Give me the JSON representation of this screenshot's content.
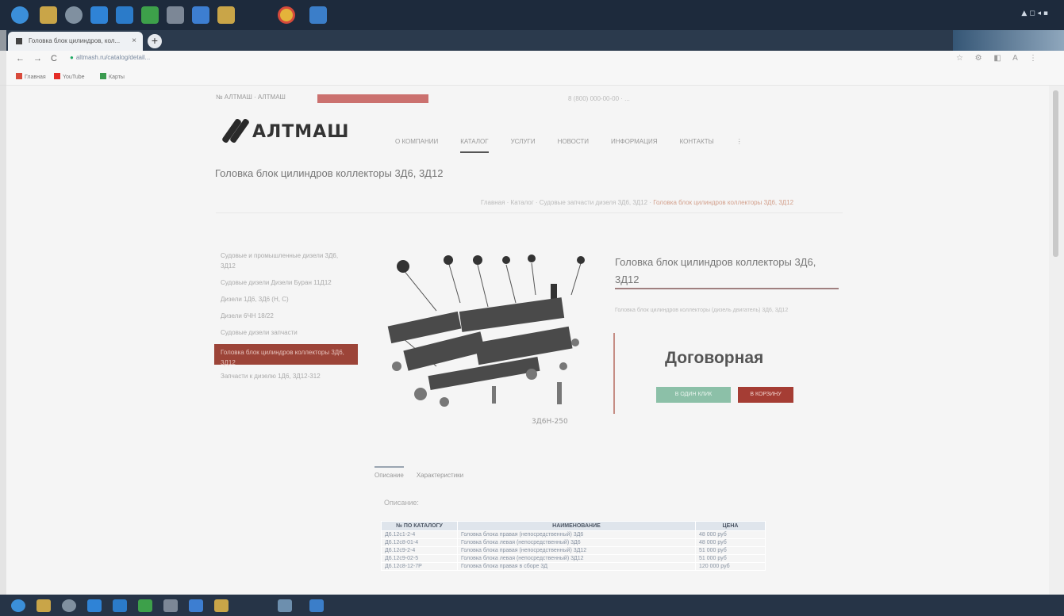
{
  "browser": {
    "tab_title": "Головка блок цилиндров, кол...",
    "url": "altmash.ru/catalog/detail...",
    "bookmarks": [
      "Главная",
      "YouTube",
      "Карты"
    ]
  },
  "site": {
    "top_links": "№ АЛТМАШ · АЛТМАШ",
    "phone": "8 (800) 000-00-00 · ...",
    "logo_text": "АЛТМАШ",
    "nav": [
      {
        "label": "О КОМПАНИИ",
        "active": false
      },
      {
        "label": "КАТАЛОГ",
        "active": true
      },
      {
        "label": "УСЛУГИ",
        "active": false
      },
      {
        "label": "НОВОСТИ",
        "active": false
      },
      {
        "label": "ИНФОРМАЦИЯ",
        "active": false
      },
      {
        "label": "КОНТАКТЫ",
        "active": false
      },
      {
        "label": "⋮",
        "active": false
      }
    ]
  },
  "page": {
    "title": "Головка блок цилиндров коллекторы 3Д6, 3Д12",
    "breadcrumb_prefix": "Главная · Каталог · Судовые запчасти дизеля 3Д6, 3Д12 · ",
    "breadcrumb_current": "Головка блок цилиндров коллекторы 3Д6, 3Д12"
  },
  "sidebar": {
    "items": [
      {
        "label": "Судовые и промышленные дизели 3Д6, 3Д12",
        "active": false
      },
      {
        "label": "Судовые дизели Дизели Буран 11Д12",
        "active": false
      },
      {
        "label": "Дизели 1Д6, 3Д6 (Н, С)",
        "active": false
      },
      {
        "label": "Дизели 6ЧН 18/22",
        "active": false
      },
      {
        "label": "Судовые дизели запчасти",
        "active": false
      },
      {
        "label": "Головка блок цилиндров коллекторы 3Д6, 3Д12",
        "active": true
      },
      {
        "label": "Запчасти к дизелю 1Д6, 3Д12-312",
        "active": false
      }
    ]
  },
  "product": {
    "title": "Головка блок цилиндров коллекторы 3Д6, 3Д12",
    "short_desc": "Головка блок цилиндров коллекторы (дизель двигатель) 3Д6, 3Д12",
    "price": "Договорная",
    "btn_order": "В ОДИН КЛИК",
    "btn_buy": "В КОРЗИНУ",
    "image_label": "3Д6Н-250"
  },
  "tabs": [
    {
      "label": "Описание",
      "active": true
    },
    {
      "label": "Характеристики",
      "active": false
    }
  ],
  "description_label": "Описание:",
  "parts_table": {
    "headers": [
      "№ ПО КАТАЛОГУ",
      "НАИМЕНОВАНИЕ",
      "ЦЕНА"
    ],
    "rows": [
      [
        "Д6.12с1-2-4",
        "Головка блока правая (непосредственный) 3Д6",
        "48 000 руб"
      ],
      [
        "Д6.12с8-01-4",
        "Головка блока левая (непосредственный) 3Д6",
        "48 000 руб"
      ],
      [
        "Д6.12с9-2-4",
        "Головка блока правая (непосредственный) 3Д12",
        "51 000 руб"
      ],
      [
        "Д6.12с9-02-5",
        "Головка блока левая (непосредственный) 3Д12",
        "51 000 руб"
      ],
      [
        "Д6.12с8-12-7Р",
        "Головка блока правая в сборе 3Д",
        "120 000 руб"
      ]
    ]
  },
  "colors": {
    "accent_red": "#a53d34",
    "accent_green": "#8cc0a8",
    "taskbar": "#1d2a3c"
  }
}
